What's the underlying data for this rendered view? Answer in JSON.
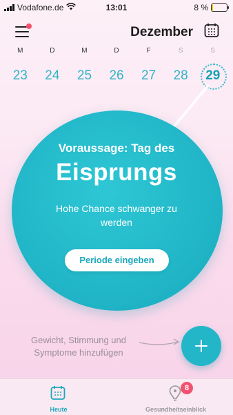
{
  "status_bar": {
    "carrier": "Vodafone.de",
    "time": "13:01",
    "battery": "8 %",
    "battery_level": 0.08
  },
  "header": {
    "month": "Dezember",
    "menu_notification": true
  },
  "week": {
    "weekdays": [
      "M",
      "D",
      "M",
      "D",
      "F",
      "S",
      "S"
    ],
    "dates": [
      "23",
      "24",
      "25",
      "26",
      "27",
      "28",
      "29"
    ],
    "selected_index": 6
  },
  "prediction": {
    "kicker": "Voraussage: Tag des",
    "title": "Eisprungs",
    "subtitle": "Hohe Chance schwanger zu werden",
    "button_label": "Periode eingeben"
  },
  "add_entry": {
    "text": "Gewicht, Stimmung und Symptome hinzufügen"
  },
  "tabs": [
    {
      "label": "Heute",
      "icon": "calendar-icon",
      "active": true
    },
    {
      "label": "Gesundheitseinblick",
      "icon": "lightbulb-pin-icon",
      "badge": "8",
      "active": false
    }
  ],
  "colors": {
    "accent": "#22b6c8",
    "badge": "#f2526e",
    "background": "#fbe8f3"
  }
}
